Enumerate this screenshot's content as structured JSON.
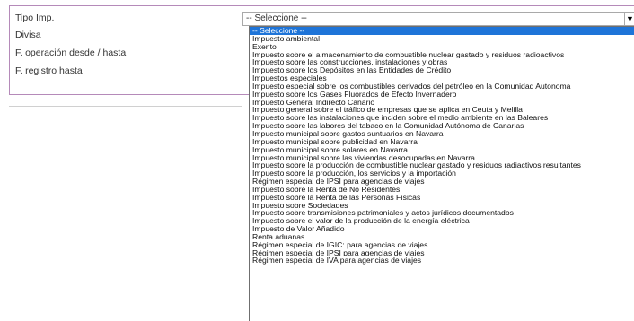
{
  "form": {
    "labels": {
      "tipo_imp": "Tipo Imp.",
      "divisa": "Divisa",
      "operacion": "F. operación desde / hasta",
      "registro": "F. registro hasta"
    },
    "tipo_imp_select": {
      "value": "-- Seleccione --",
      "arrow": "▼"
    }
  },
  "dropdown": {
    "selected_index": 0,
    "options": [
      "-- Seleccione --",
      "Impuesto ambiental",
      "Exento",
      "Impuesto sobre el almacenamiento de combustible nuclear gastado y residuos radioactivos",
      "Impuesto sobre las construcciones, instalaciones y obras",
      "Impuesto sobre los Depósitos en las Entidades de Crédito",
      "Impuestos especiales",
      "Impuesto especial sobre los combustibles derivados del petróleo en la Comunidad Autonoma",
      "Impuesto sobre los Gases Fluorados de Efecto Invernadero",
      "Impuesto General Indirecto Canario",
      "Impuesto general sobre el tráfico de empresas que se aplica en Ceuta y Melilla",
      "Impuesto sobre las instalaciones que inciden sobre el medio ambiente en las Baleares",
      "Impuesto sobre las labores del tabaco en la Comunidad Autónoma de Canarias",
      "Impuesto municipal sobre gastos suntuarios en Navarra",
      "Impuesto municipal sobre publicidad en Navarra",
      "Impuesto municipal sobre solares en Navarra",
      "Impuesto municipal sobre las viviendas desocupadas en Navarra",
      "Impuesto sobre la producción de combustible nuclear gastado y residuos radiactivos resultantes",
      "Impuesto sobre la producción, los servicios y la importación",
      "Régimen especial de IPSI para agencias de viajes",
      "Impuesto sobre la Renta de No Residentes",
      "Impuesto sobre la Renta de las Personas Físicas",
      "Impuesto sobre Sociedades",
      "Impuesto sobre transmisiones patrimoniales y actos jurídicos documentados",
      "Impuesto sobre el valor de la producción de la energía eléctrica",
      "Impuesto de Valor Añadido",
      "Renta aduanas",
      "Régimen especial de IGIC: para agencias de viajes",
      "Régimen especial de IPSI para agencias de viajes",
      "Régimen especial de IVA para agencias de viajes"
    ]
  }
}
